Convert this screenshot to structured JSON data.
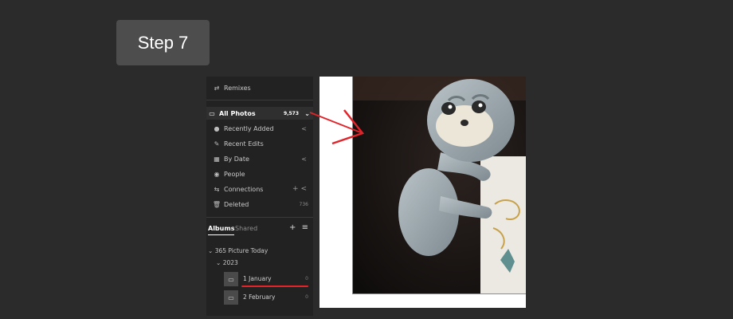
{
  "step": {
    "label": "Step 7"
  },
  "sidebar": {
    "remixes": "Remixes",
    "all_photos": {
      "label": "All Photos",
      "count": "9,573"
    },
    "items": [
      {
        "label": "Recently Added",
        "icon": "clock-icon",
        "chevron": "<"
      },
      {
        "label": "Recent Edits",
        "icon": "edit-icon",
        "chevron": ""
      },
      {
        "label": "By Date",
        "icon": "calendar-icon",
        "chevron": "<"
      },
      {
        "label": "People",
        "icon": "person-icon",
        "chevron": ""
      },
      {
        "label": "Connections",
        "icon": "connections-icon",
        "chevron": "+ <"
      },
      {
        "label": "Deleted",
        "icon": "trash-icon",
        "count": "736"
      }
    ],
    "tabs": {
      "albums": "Albums",
      "shared": "Shared"
    },
    "tree": {
      "root": "365 Picture Today",
      "year": "2023",
      "albums": [
        {
          "name": "1 January",
          "count": "0"
        },
        {
          "name": "2 February",
          "count": "0"
        }
      ]
    }
  },
  "colors": {
    "annotation": "#e0242a",
    "background": "#2b2b2b",
    "sidebar": "#222222"
  }
}
